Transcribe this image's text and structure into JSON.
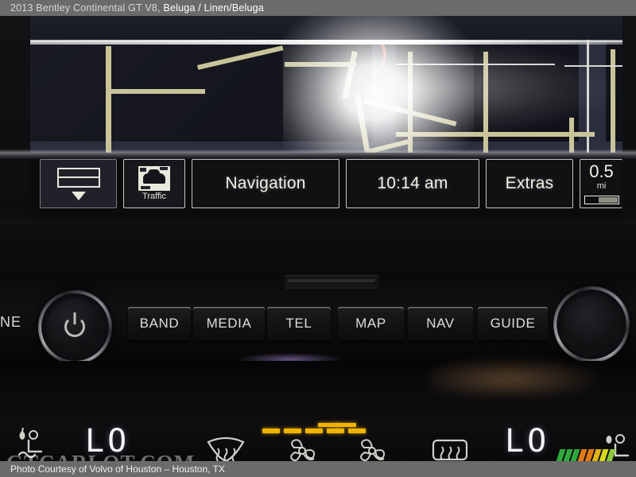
{
  "titlebar": {
    "vehicle": "2013 Bentley Continental GT V8,",
    "colors": "Beluga / Linen/Beluga"
  },
  "footer": {
    "credit": "Photo Courtesy of Volvo of Houston – Houston, TX"
  },
  "watermark": {
    "text": "GTCARLOT.COM"
  },
  "nav_screen": {
    "map": {
      "description": "night-mode navigation map with tan surface streets and dark highways",
      "route_color": "#e86a63",
      "road_color": "#c9c39a",
      "highway_color": "#2a2e3d",
      "background_color": "#141520"
    },
    "menu_bar": {
      "items": [
        {
          "id": "list",
          "icon": "list-icon",
          "label": ""
        },
        {
          "id": "traffic",
          "icon": "traffic-icon",
          "label": "Traffic"
        },
        {
          "id": "navigation",
          "icon": "",
          "label": "Navigation"
        },
        {
          "id": "clock",
          "icon": "",
          "label": "10:14 am"
        },
        {
          "id": "extras",
          "icon": "",
          "label": "Extras"
        }
      ],
      "distance": {
        "value": "0.5",
        "unit": "mi"
      }
    }
  },
  "fascia": {
    "left_knob": {
      "icon": "power-icon",
      "label": "NE"
    },
    "right_knob": {
      "icon": "tune-knob"
    },
    "cd_slot": "media-slot",
    "buttons": [
      {
        "label": "BAND"
      },
      {
        "label": "MEDIA"
      },
      {
        "label": "TEL"
      },
      {
        "label": "MAP"
      },
      {
        "label": "NAV"
      },
      {
        "label": "GUIDE"
      }
    ]
  },
  "climate": {
    "left_temp": "LO",
    "right_temp": "LO",
    "fan_indicator_segments": 5,
    "left_side_segments": 2,
    "right_side_segments": 3,
    "indicator_color": "#f0b400",
    "icons": [
      {
        "name": "seat-ventilation-icon",
        "side": "left"
      },
      {
        "name": "front-defrost-icon",
        "side": "left-center"
      },
      {
        "name": "fan-icon",
        "side": "center-left"
      },
      {
        "name": "fan-icon",
        "side": "center-right"
      },
      {
        "name": "rear-defrost-icon",
        "side": "right-center"
      },
      {
        "name": "seat-ventilation-icon",
        "side": "right"
      }
    ]
  },
  "logo": {
    "stripe_colors": [
      "#2fa83c",
      "#2fa83c",
      "#2fa83c",
      "#e07a14",
      "#e07a14",
      "#e0b414",
      "#d7d71e",
      "#8fc93a"
    ]
  }
}
